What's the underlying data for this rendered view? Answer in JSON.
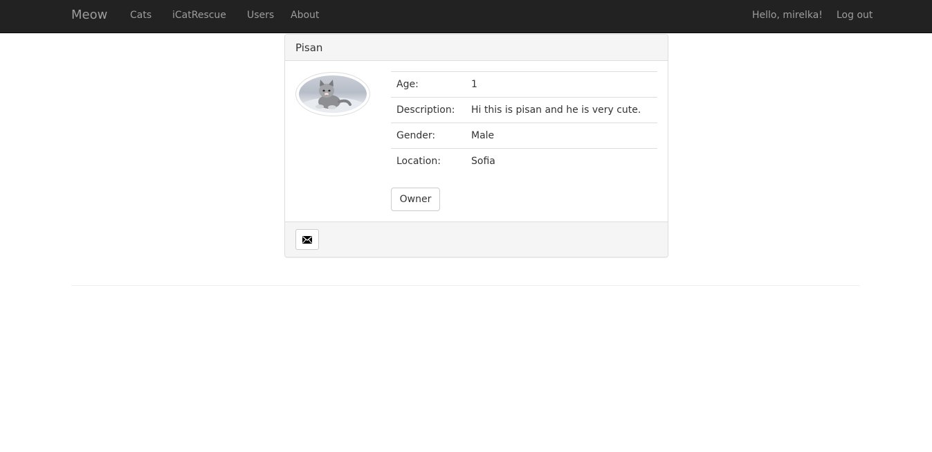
{
  "navbar": {
    "brand": "Meow",
    "links": [
      "Cats",
      "iCatRescue",
      "Users",
      "About"
    ],
    "greeting": "Hello, mirelka!",
    "logout": "Log out"
  },
  "cat": {
    "name": "Pisan",
    "details": [
      {
        "label": "Age:",
        "value": "1"
      },
      {
        "label": "Description:",
        "value": "Hi this is pisan and he is very cute."
      },
      {
        "label": "Gender:",
        "value": "Male"
      },
      {
        "label": "Location:",
        "value": "Sofia"
      }
    ],
    "owner_button": "Owner"
  },
  "icons": {
    "message": "envelope-icon",
    "photo": "cat-photo"
  },
  "colors": {
    "navbar_bg": "#222222",
    "nav_text": "#9d9d9d",
    "panel_heading_bg": "#f5f5f5",
    "border": "#dddddd"
  }
}
